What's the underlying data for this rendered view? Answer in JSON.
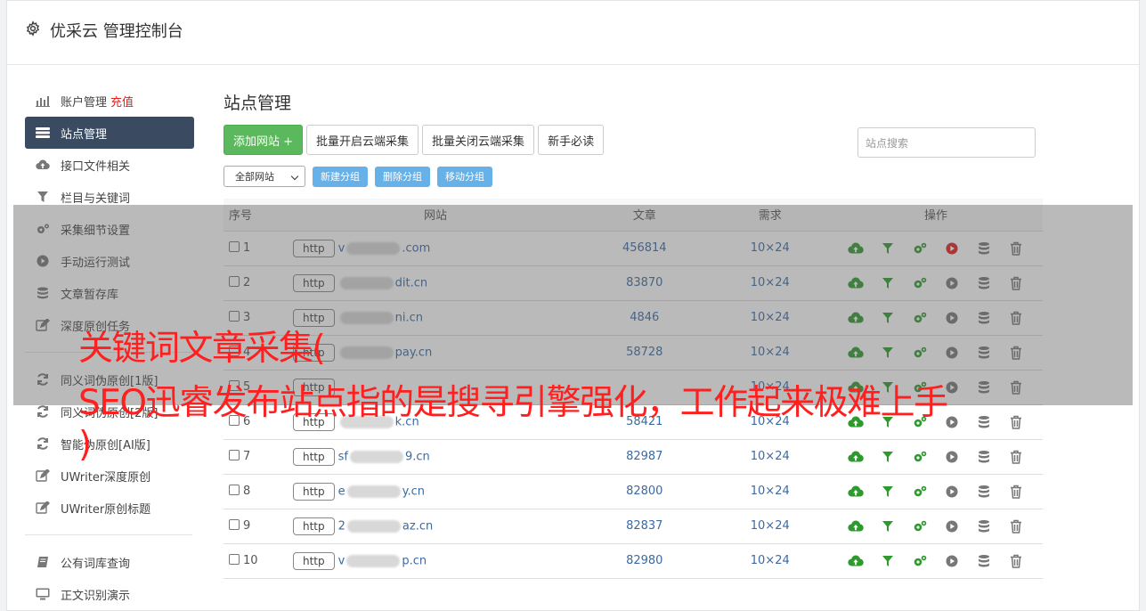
{
  "app": {
    "title": "优采云 管理控制台",
    "icon": "gear-icon"
  },
  "sidebar": {
    "items": [
      {
        "label": "账户管理",
        "extra": "充值",
        "icon": "bar-chart-icon"
      },
      {
        "label": "站点管理",
        "icon": "server-list-icon",
        "active": true
      },
      {
        "label": "接口文件相关",
        "icon": "cloud-upload-icon"
      },
      {
        "label": "栏目与关键词",
        "icon": "filter-icon"
      },
      {
        "label": "采集细节设置",
        "icon": "cogs-icon"
      },
      {
        "label": "手动运行测试",
        "icon": "play-circle-icon"
      },
      {
        "label": "文章暂存库",
        "icon": "database-icon"
      },
      {
        "label": "深度原创任务",
        "icon": "edit-icon"
      }
    ],
    "group2": [
      {
        "label": "同义词伪原创[1版]",
        "icon": "refresh-icon"
      },
      {
        "label": "同义词伪原创[2版]",
        "icon": "refresh-icon"
      },
      {
        "label": "智能伪原创[AI版]",
        "icon": "refresh-icon"
      },
      {
        "label": "UWriter深度原创",
        "icon": "edit-icon"
      },
      {
        "label": "UWriter原创标题",
        "icon": "edit-icon"
      }
    ],
    "group3": [
      {
        "label": "公有词库查询",
        "icon": "book-icon"
      },
      {
        "label": "正文识别演示",
        "icon": "monitor-icon"
      }
    ]
  },
  "main": {
    "title": "站点管理",
    "buttons": {
      "add_site": "添加网站 +",
      "batch_enable": "批量开启云端采集",
      "batch_disable": "批量关闭云端采集",
      "newbie": "新手必读"
    },
    "search_placeholder": "站点搜索",
    "group_select": "全部网站",
    "group_buttons": {
      "new": "新建分组",
      "delete": "删除分组",
      "move": "移动分组"
    },
    "table": {
      "headers": [
        "序号",
        "网站",
        "文章",
        "需求",
        "操作"
      ],
      "rows": [
        {
          "idx": "1",
          "prefix": "http",
          "head": "v",
          "tail": ".com",
          "articles": "456814",
          "demand": "10×24",
          "running": true
        },
        {
          "idx": "2",
          "prefix": "http",
          "head": "",
          "tail": "dit.cn",
          "articles": "83870",
          "demand": "10×24"
        },
        {
          "idx": "3",
          "prefix": "http",
          "head": "",
          "tail": "ni.cn",
          "articles": "4846",
          "demand": "10×24"
        },
        {
          "idx": "4",
          "prefix": "http",
          "head": "",
          "tail": "pay.cn",
          "articles": "58728",
          "demand": "10×24"
        },
        {
          "idx": "5",
          "prefix": "http",
          "head": "",
          "tail": "",
          "articles": "",
          "demand": "10×24"
        },
        {
          "idx": "6",
          "prefix": "http",
          "head": "",
          "tail": "k.cn",
          "articles": "58421",
          "demand": "10×24"
        },
        {
          "idx": "7",
          "prefix": "http",
          "head": "sf",
          "tail": "9.cn",
          "articles": "82987",
          "demand": "10×24"
        },
        {
          "idx": "8",
          "prefix": "http",
          "head": "e",
          "tail": "y.cn",
          "articles": "82800",
          "demand": "10×24"
        },
        {
          "idx": "9",
          "prefix": "http",
          "head": "2",
          "tail": "az.cn",
          "articles": "82837",
          "demand": "10×24"
        },
        {
          "idx": "10",
          "prefix": "http",
          "head": "v",
          "tail": "p.cn",
          "articles": "82980",
          "demand": "10×24"
        }
      ]
    }
  },
  "caption": {
    "line1": "关键词文章采集(",
    "line2": "SEO迅睿发布站点指的是搜寻引擎强化，工作起来极难上手",
    "line3": ")"
  },
  "colors": {
    "sidebar_active": "#3a4a61",
    "add_button": "#5cb85c",
    "group_button": "#66b1e8",
    "caption": "#ff1f1f",
    "link": "#3a6aa5"
  }
}
